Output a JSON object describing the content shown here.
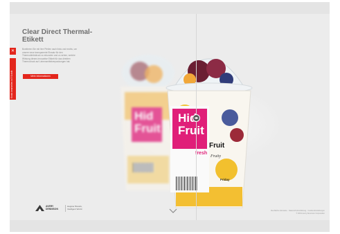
{
  "hero": {
    "title": "Clear Direct Thermal-Etikett",
    "body": "Bonitieren Sie mit Ihre Pfeilen nach links und rechts, um unsere neue transparente Einsatz für den Thermodirektdruck zu erkunden und zu sehen, welche Wirkung dieses innovative Etikett für das direkten Thermodruck auf Lebensmittelverpackungen hat.",
    "cta_label": "Mehr Informationen"
  },
  "side_tab": {
    "top_glyph": "✕",
    "label": "Konto bearbeiten in 3 Schritt"
  },
  "product": {
    "label_text_1": "Hid",
    "label_text_2": "Fruit",
    "label_text_3": "fresh",
    "right_text_1": "Fruit",
    "right_text_2": "Fruity",
    "right_text_3": "Friday"
  },
  "slider": {
    "handle_glyph": "◂▸"
  },
  "brand": {
    "name_line1": "AVERY",
    "name_line2": "DENNISON",
    "tag_line1": "Happier Brands,",
    "tag_line2": "Intelligent World"
  },
  "footer": {
    "line1": "Rechtliche Hinweise · Datenschutzerklärung · Cookie-Einstellungen",
    "line2": "© 2019 Avery Dennison Corporation"
  },
  "rail": {
    "dots": [
      {
        "color": "#7fb04a"
      },
      {
        "color": "#d6d6d6"
      },
      {
        "color": "#4aa0d9"
      },
      {
        "color": "#e89a2e"
      },
      {
        "color": "#58b86a"
      },
      {
        "color": "#e3261c"
      },
      {
        "color": "#9b6fd0"
      }
    ]
  },
  "colors": {
    "accent": "#e3261c",
    "label_pink": "#e01f79",
    "rail": "#5d5d5d"
  }
}
